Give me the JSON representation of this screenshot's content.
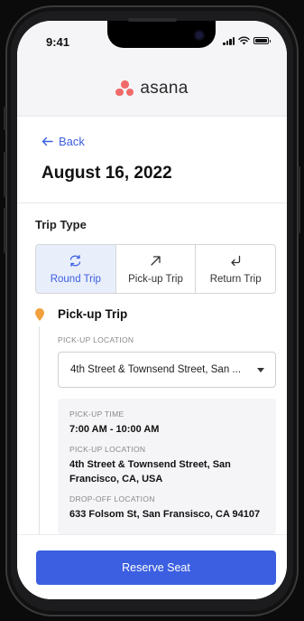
{
  "status_bar": {
    "time": "9:41",
    "icons": [
      "signal-icon",
      "wifi-icon",
      "battery-icon"
    ]
  },
  "brand": {
    "name": "asana",
    "logo": "asana-logo-icon",
    "logo_color": "#f06a6a"
  },
  "nav": {
    "back_label": "Back",
    "back_icon": "arrow-left-icon"
  },
  "page": {
    "title": "August 16, 2022"
  },
  "trip_type": {
    "label": "Trip Type",
    "options": [
      {
        "label": "Round Trip",
        "icon": "round-trip-icon",
        "selected": true
      },
      {
        "label": "Pick-up Trip",
        "icon": "arrow-up-right-icon",
        "selected": false
      },
      {
        "label": "Return Trip",
        "icon": "return-arrow-icon",
        "selected": false
      }
    ]
  },
  "pickup": {
    "heading": "Pick-up Trip",
    "location_label": "PICK-UP LOCATION",
    "location_value": "4th Street & Townsend Street, San Francisco, CA, USA",
    "location_value_display": "4th Street & Townsend Street, San ...",
    "summary": {
      "time_label": "PICK-UP TIME",
      "time_value": "7:00 AM - 10:00 AM",
      "pickup_label": "PICK-UP LOCATION",
      "pickup_value": "4th Street & Townsend Street, San Francisco, CA, USA",
      "dropoff_label": "DROP-OFF LOCATION",
      "dropoff_value": "633 Folsom St, San Fransisco, CA 94107"
    }
  },
  "footer": {
    "reserve_label": "Reserve Seat"
  },
  "colors": {
    "accent": "#3b5fe0",
    "selected_bg": "#e9eefb",
    "pin": "#f2a03d"
  }
}
